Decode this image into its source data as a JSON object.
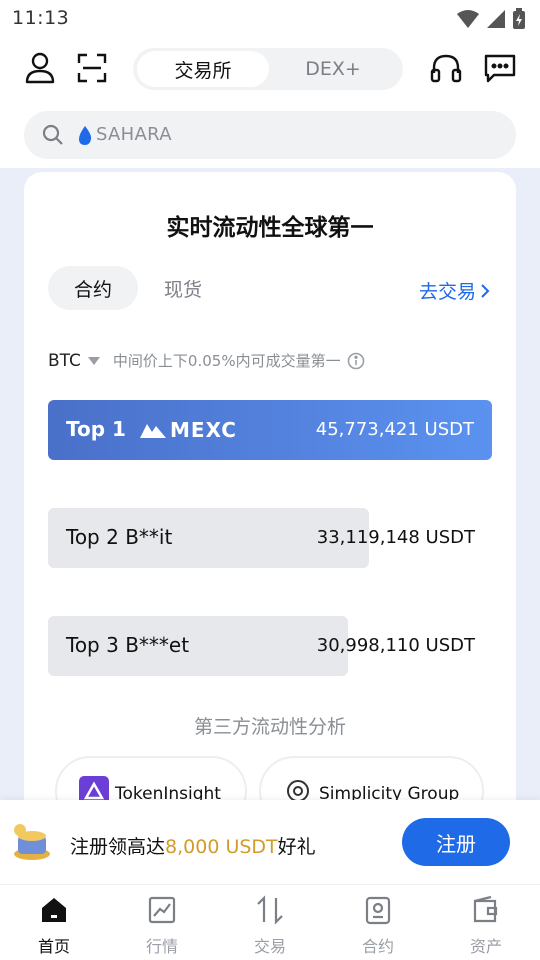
{
  "status": {
    "time": "11:13"
  },
  "top_nav": {
    "tabs": [
      "交易所",
      "DEX+"
    ]
  },
  "search": {
    "placeholder": "SAHARA"
  },
  "card": {
    "title": "实时流动性全球第一",
    "tabs": [
      "合约",
      "现货"
    ],
    "go_trade": "去交易",
    "market": {
      "asset": "BTC",
      "description": "中间价上下0.05%内可成交量第一"
    },
    "ranks": [
      {
        "label": "Top 1",
        "exchange": "MEXC",
        "value": "45,773,421 USDT"
      },
      {
        "label": "Top 2 B**it",
        "value": "33,119,148 USDT"
      },
      {
        "label": "Top 3 B***et",
        "value": "30,998,110 USDT"
      }
    ],
    "section_title": "第三方流动性分析",
    "partners": [
      "TokenInsight",
      "Simplicity Group"
    ]
  },
  "promo": {
    "text_before": "注册领高达",
    "amount": "8,000 USDT",
    "text_after": "好礼",
    "button": "注册"
  },
  "bottom_nav": [
    "首页",
    "行情",
    "交易",
    "合约",
    "资产"
  ],
  "colors": {
    "brand": "#1f6ae6",
    "gold": "#d39b2c"
  }
}
